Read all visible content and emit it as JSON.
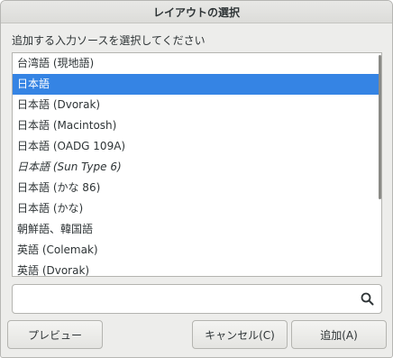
{
  "dialog": {
    "title": "レイアウトの選択",
    "prompt": "追加する入力ソースを選択してください"
  },
  "layouts": {
    "selected_index": 1,
    "items": [
      {
        "label": "台湾語 (現地語)",
        "italic": false
      },
      {
        "label": "日本語",
        "italic": false
      },
      {
        "label": "日本語 (Dvorak)",
        "italic": false
      },
      {
        "label": "日本語 (Macintosh)",
        "italic": false
      },
      {
        "label": "日本語 (OADG 109A)",
        "italic": false
      },
      {
        "label": "日本語 (Sun Type 6)",
        "italic": true
      },
      {
        "label": "日本語 (かな 86)",
        "italic": false
      },
      {
        "label": "日本語 (かな)",
        "italic": false
      },
      {
        "label": "朝鮮語、韓国語",
        "italic": false
      },
      {
        "label": "英語 (Colemak)",
        "italic": false
      },
      {
        "label": "英語 (Dvorak)",
        "italic": false
      }
    ]
  },
  "search": {
    "value": "",
    "placeholder": "",
    "icon": "search-icon"
  },
  "buttons": {
    "preview": "プレビュー",
    "cancel": "キャンセル(C)",
    "add": "追加(A)"
  },
  "colors": {
    "selection": "#3584e4",
    "window_bg": "#ededeb"
  }
}
